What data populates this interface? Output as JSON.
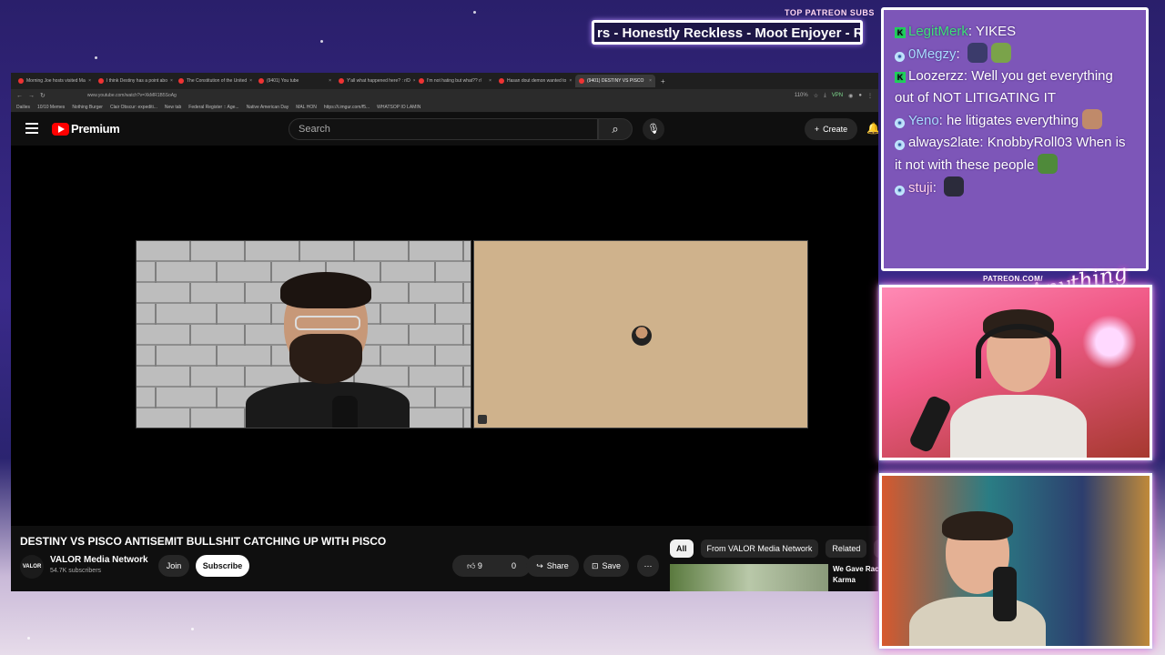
{
  "overlay": {
    "patreon_title": "TOP PATREON SUBS",
    "marquee_text": "rs - Honestly Reckless - Moot Enjoyer - Re",
    "patreon_url": "PATREON.COM/",
    "brand_script": "Anything Else?"
  },
  "browser": {
    "tabs": [
      {
        "label": "Morning Joe hosts visited Ma",
        "active": false
      },
      {
        "label": "I think Destiny has a point abo",
        "active": false
      },
      {
        "label": "The Constitution of the United",
        "active": false
      },
      {
        "label": "(9401) You tube",
        "active": false
      },
      {
        "label": "Y'all what happened here? : r/D",
        "active": false
      },
      {
        "label": "I'm not hating but what?? r/",
        "active": false
      },
      {
        "label": "Hasan dout demon wanted to",
        "active": false
      },
      {
        "label": "(9401) DESTINY VS PISCO",
        "active": true
      }
    ],
    "url": "www.youtube.com/watch?v=XkMR1B5SoAg",
    "zoom": "110%",
    "vpn_label": "VPN",
    "bookmarks": [
      "Dailies",
      "10/10 Memes",
      "Nothing Burger",
      "Clair Obscur: expediti...",
      "New tab",
      "Federal Register :: Age...",
      "Native American Day",
      "MAL HON",
      "https://i.imgur.com/f5...",
      "WHATSOP IO LAMIN"
    ]
  },
  "youtube": {
    "logo_text": "Premium",
    "search_placeholder": "Search",
    "create_label": "Create",
    "video_title": "DESTINY VS PISCO ANTISEMIT BULLSHIT CATCHING UP WITH PISCO",
    "channel_avatar_text": "VALOR",
    "channel_name": "VALOR Media Network",
    "subscribers": "54.7K subscribers",
    "join_label": "Join",
    "subscribe_label": "Subscribe",
    "likes": "9",
    "dislikes": "0",
    "share_label": "Share",
    "save_label": "Save",
    "chips": [
      "All",
      "From VALOR Media Network",
      "Related",
      "Fo"
    ],
    "rec_title": "We Gave Rac Karma"
  },
  "chat": [
    {
      "badge": "K",
      "user": "LegitMerk",
      "user_color": "#3fe07a",
      "text": "YIKES",
      "emotes": []
    },
    {
      "badge": "P",
      "user": "0Megzy",
      "user_color": "#a9dcff",
      "text": "",
      "emotes": [
        "#3b3b6b",
        "#7aa34a"
      ]
    },
    {
      "badge": "K",
      "user": "Loozerzz",
      "user_color": "#ffffff",
      "text": "Well you get everything out of NOT LITIGATING IT",
      "emotes": []
    },
    {
      "badge": "P",
      "user": "Yeno",
      "user_color": "#a9dcff",
      "text": "he litigates everything",
      "emotes": [
        "#c08a6a"
      ]
    },
    {
      "badge": "P",
      "user": "always2late",
      "user_color": "#ffffff",
      "text": "KnobbyRoll03 When is it not with these people",
      "emotes": [
        "#4f8a3a"
      ]
    },
    {
      "badge": "P",
      "user": "stuji",
      "user_color": "#ffd1e8",
      "text": "",
      "emotes": [
        "#2b2b3b"
      ]
    }
  ],
  "colors": {
    "accent_red": "#ff0000",
    "chat_bg": "#7d56b8",
    "cam_glow": "#ff5fd2"
  }
}
